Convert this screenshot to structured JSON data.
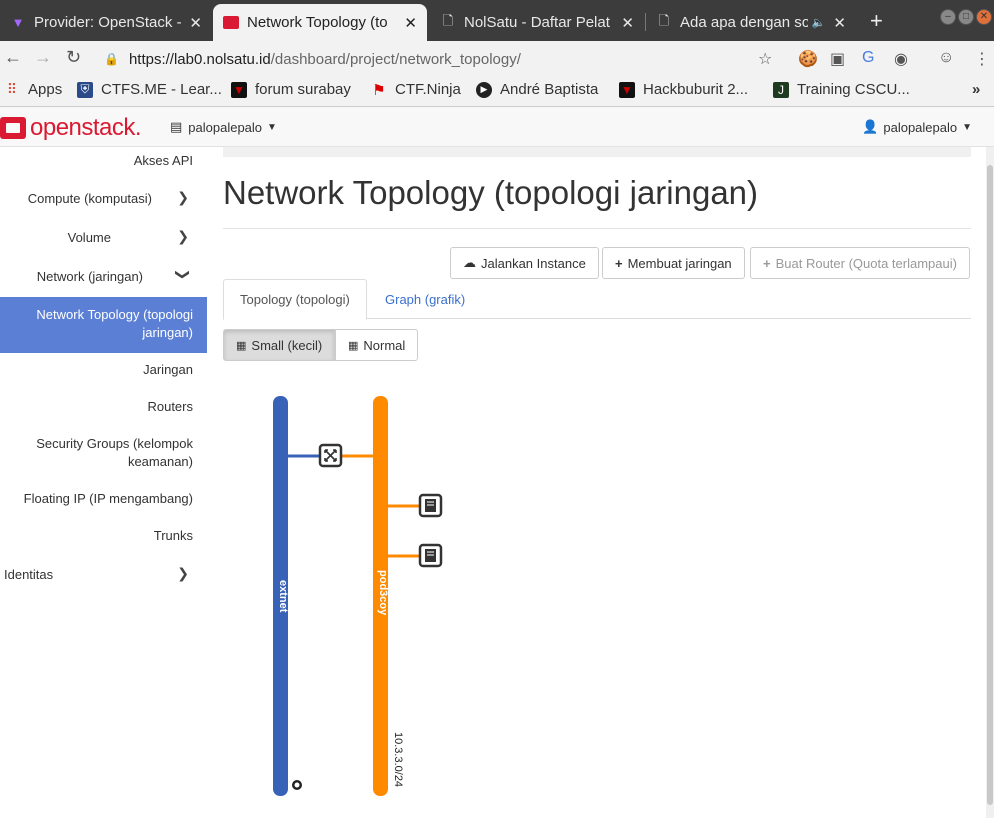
{
  "browser": {
    "tabs": [
      {
        "title": "Provider: OpenStack -",
        "favicon": "openstack-provider-icon"
      },
      {
        "title": "Network Topology (to",
        "favicon": "openstack-icon"
      },
      {
        "title": "NolSatu - Daftar Pelat",
        "favicon": "page-icon"
      },
      {
        "title": "Ada apa dengan so",
        "favicon": "page-icon"
      }
    ],
    "url_host": "https://lab0.nolsatu.id",
    "url_path": "/dashboard/project/network_topology/",
    "bookmarks": [
      "Apps",
      "CTFS.ME - Lear...",
      "forum surabay",
      "CTF.Ninja",
      "André Baptista",
      "Hackbuburit 2...",
      "Training CSCU..."
    ]
  },
  "header": {
    "logo": "openstack.",
    "project": "palopalepalo",
    "user": "palopalepalo"
  },
  "sidebar": {
    "items": [
      {
        "label": "Akses API"
      },
      {
        "label": "Compute (komputasi)"
      },
      {
        "label": "Volume"
      },
      {
        "label": "Network (jaringan)"
      },
      {
        "label": "Network Topology (topologi jaringan)"
      },
      {
        "label": "Jaringan"
      },
      {
        "label": "Routers"
      },
      {
        "label": "Security Groups (kelompok keamanan)"
      },
      {
        "label": "Floating IP (IP mengambang)"
      },
      {
        "label": "Trunks"
      },
      {
        "label": "Identitas"
      }
    ]
  },
  "main": {
    "title": "Network Topology (topologi jaringan)",
    "actions": {
      "launch_instance": "Jalankan Instance",
      "create_network": "Membuat jaringan",
      "create_router": "Buat Router (Quota terlampaui)"
    },
    "tabs": {
      "topology": "Topology (topologi)",
      "graph": "Graph (grafik)"
    },
    "size": {
      "small": "Small (kecil)",
      "normal": "Normal"
    }
  },
  "topology": {
    "networks": [
      {
        "name": "extnet",
        "color": "#3862b8"
      },
      {
        "name": "pod3coy",
        "color": "#ff8a00",
        "cidr": "10.3.3.0/24"
      }
    ]
  },
  "colors": {
    "accent": "#5b7fd4",
    "brand": "#da1a32"
  }
}
